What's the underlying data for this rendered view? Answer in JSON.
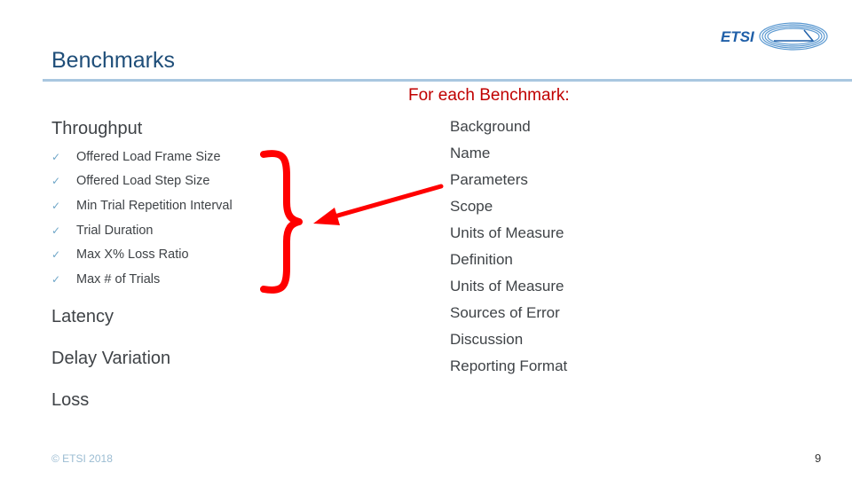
{
  "slide": {
    "title": "Benchmarks",
    "logo_text": "ETSI",
    "accent_color": "#1f4e79",
    "highlight_color": "#c00000",
    "arrow_color": "#ff0000"
  },
  "left": {
    "sections": [
      {
        "heading": "Throughput",
        "items": [
          "Offered Load Frame Size",
          "Offered Load Step Size",
          "Min Trial Repetition Interval",
          "Trial Duration",
          "Max X% Loss Ratio",
          "Max # of Trials"
        ]
      },
      {
        "heading": "Latency"
      },
      {
        "heading": "Delay Variation"
      },
      {
        "heading": "Loss"
      }
    ],
    "bullet_icon": "checkmark-icon",
    "bullet_glyph": "✓"
  },
  "right": {
    "heading": "For each Benchmark:",
    "items": [
      "Background",
      "Name",
      "Parameters",
      "Scope",
      "Units of Measure",
      "Definition",
      "Units of Measure",
      "Sources of Error",
      "Discussion",
      "Reporting Format"
    ]
  },
  "footer": {
    "copyright": "© ETSI 2018",
    "page_number": "9"
  }
}
